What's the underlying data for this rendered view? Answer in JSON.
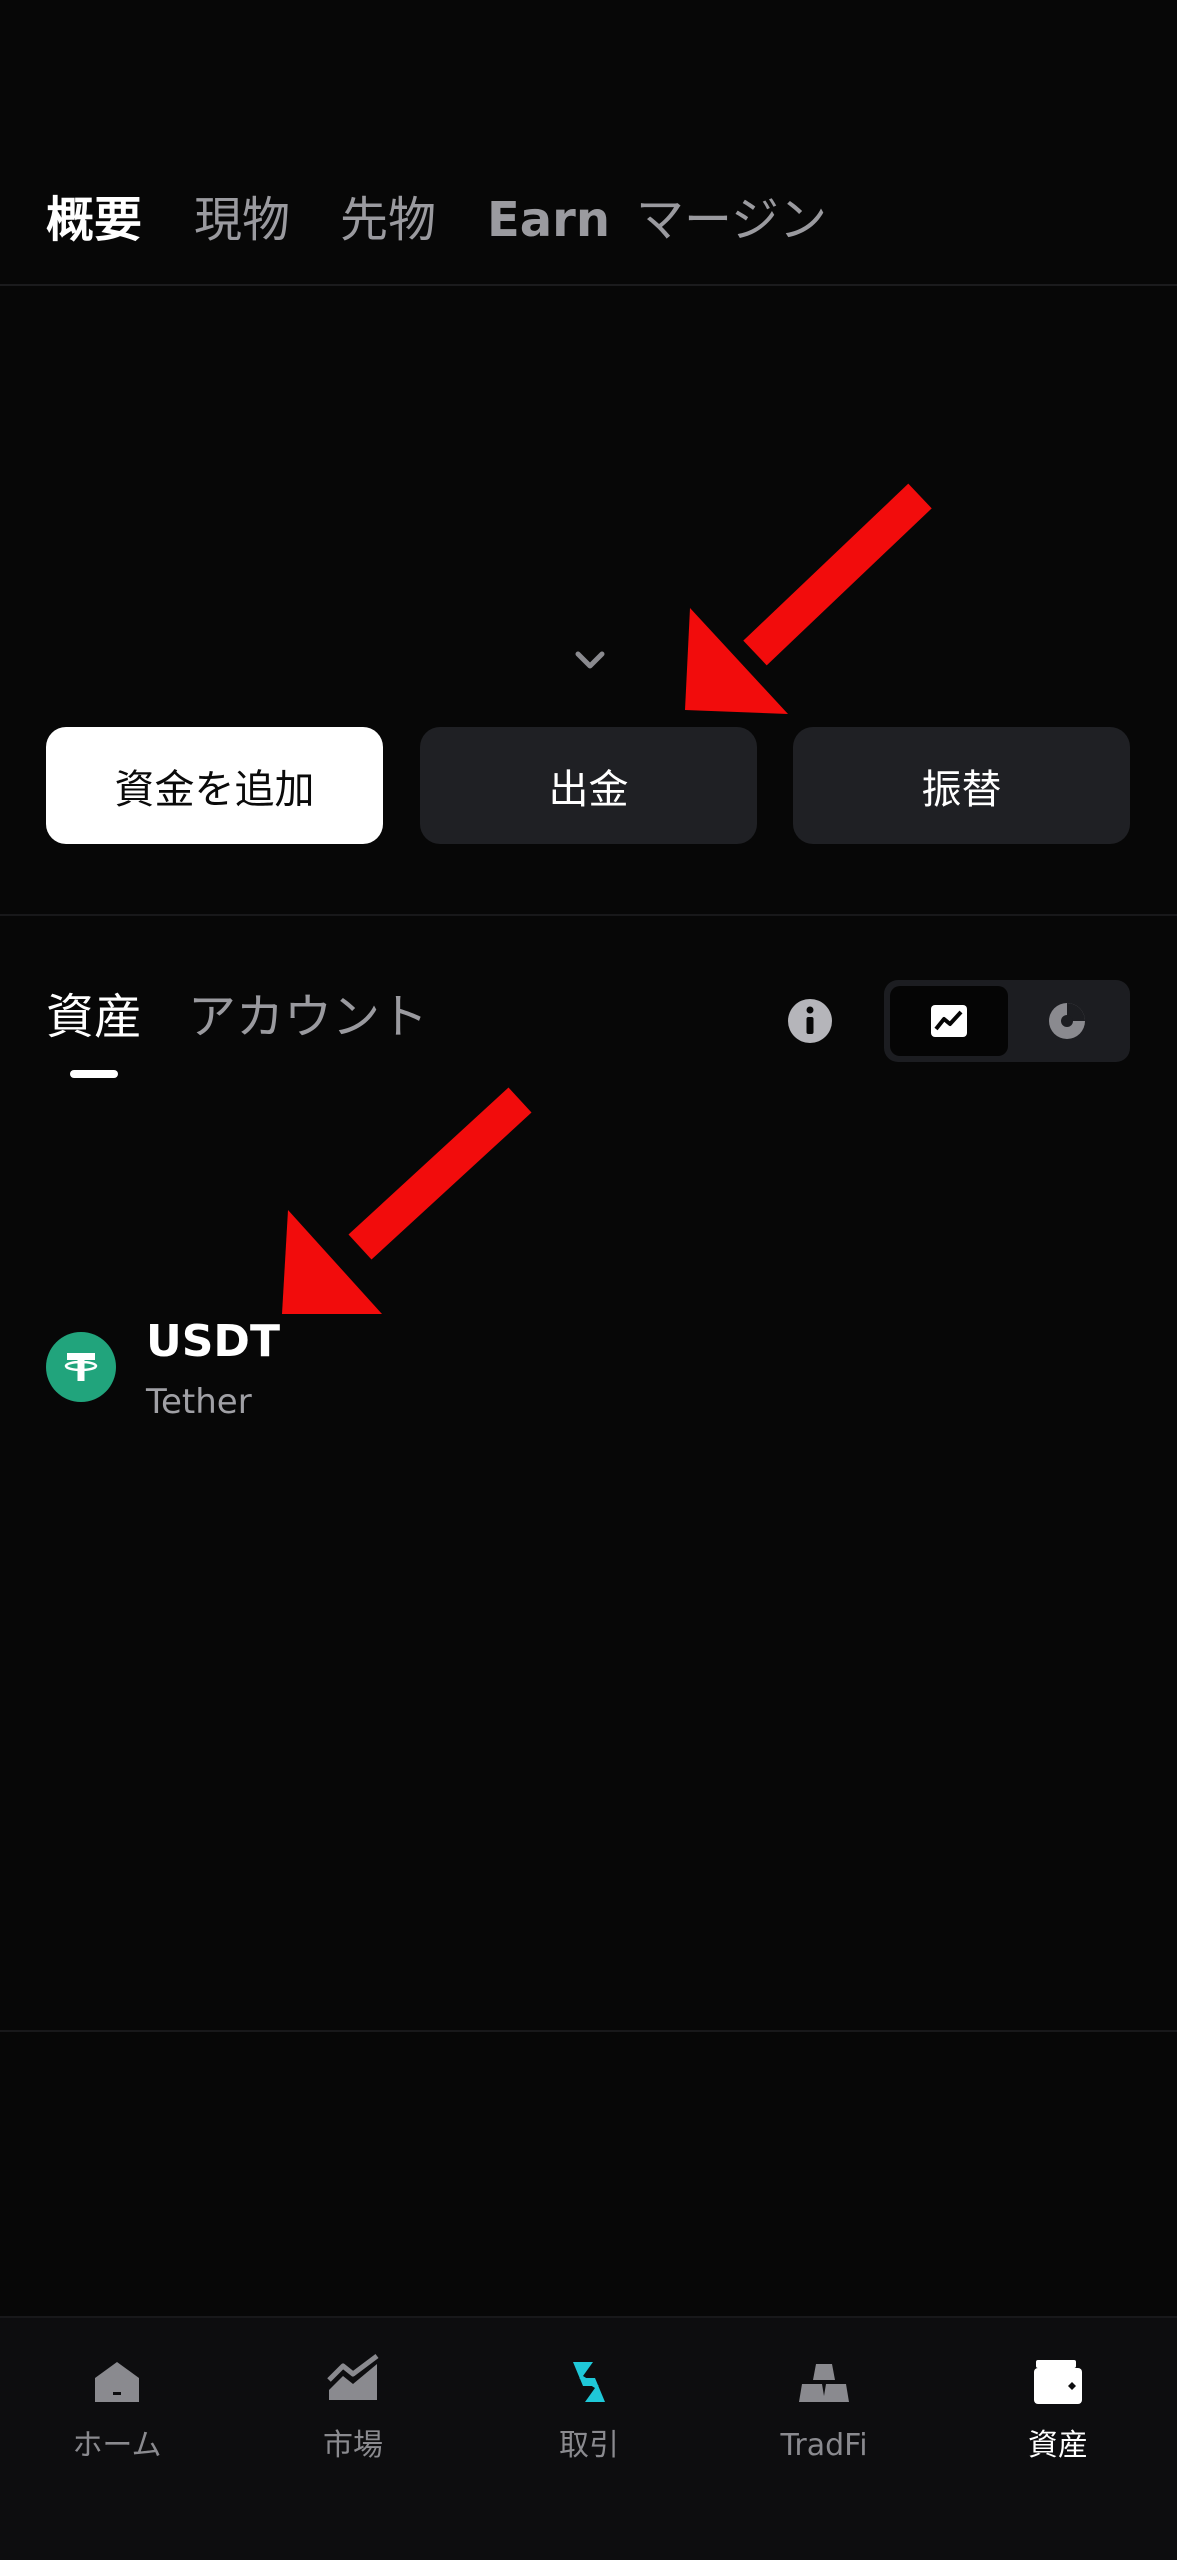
{
  "top_tabs": [
    {
      "label": "概要",
      "active": true
    },
    {
      "label": "現物",
      "active": false
    },
    {
      "label": "先物",
      "active": false
    },
    {
      "label": "Earn",
      "active": false
    },
    {
      "label": "マージン",
      "active": false
    }
  ],
  "actions": {
    "add_funds": "資金を追加",
    "withdraw": "出金",
    "transfer": "振替"
  },
  "asset_tabs": [
    {
      "label": "資産",
      "active": true
    },
    {
      "label": "アカウント",
      "active": false
    }
  ],
  "view_toggle": {
    "options": [
      "chart-icon",
      "pie-chart-icon"
    ],
    "selected": "chart-icon"
  },
  "assets": [
    {
      "symbol": "USDT",
      "name": "Tether",
      "icon": "tether-logo",
      "color": "#21a47c"
    }
  ],
  "bottom_nav": [
    {
      "label": "ホーム",
      "icon": "home-icon",
      "active": false
    },
    {
      "label": "市場",
      "icon": "market-icon",
      "active": false
    },
    {
      "label": "取引",
      "icon": "trade-icon",
      "active": false
    },
    {
      "label": "TradFi",
      "icon": "gold-bars-icon",
      "active": false
    },
    {
      "label": "資産",
      "icon": "wallet-icon",
      "active": true
    }
  ],
  "colors": {
    "background": "#070707",
    "button_dark": "#1f2024",
    "accent_trade": "#1fc8d8",
    "tether_green": "#21a47c",
    "annotation_red": "#f20c0c"
  }
}
